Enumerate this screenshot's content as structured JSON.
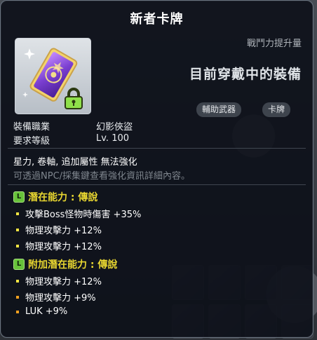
{
  "item": {
    "title": "新者卡牌",
    "power_label": "戰鬥力提升量",
    "equip_state": "目前穿戴中的裝備",
    "tags": [
      "輔助武器",
      "卡牌"
    ]
  },
  "requirements": [
    {
      "label": "裝備職業",
      "value": "幻影俠盜"
    },
    {
      "label": "要求等級",
      "value": "Lv. 100"
    }
  ],
  "properties": "星力, 卷軸, 追加屬性 無法強化",
  "hint": "可透過NPC/採集鍵查看強化資訊詳細內容。",
  "potential": {
    "header": "潛在能力 : 傳說",
    "lines": [
      "攻擊Boss怪物時傷害 +35%",
      "物理攻擊力 +12%",
      "物理攻擊力 +12%"
    ]
  },
  "bonus_potential": {
    "header": "附加潛在能力 : 傳說",
    "lines": [
      "物理攻擊力 +12%",
      "物理攻擊力 +9%",
      "LUK +9%"
    ]
  },
  "colors": {
    "potential_header": "#e8d630",
    "legendary_icon": "#67c23a",
    "bullet_yellow": "#f2e442",
    "bullet_orange": "#f0a020"
  },
  "icons": {
    "item_image": "card-icon",
    "lock": "lock-icon",
    "potential_grade": "legendary-grade-icon"
  }
}
